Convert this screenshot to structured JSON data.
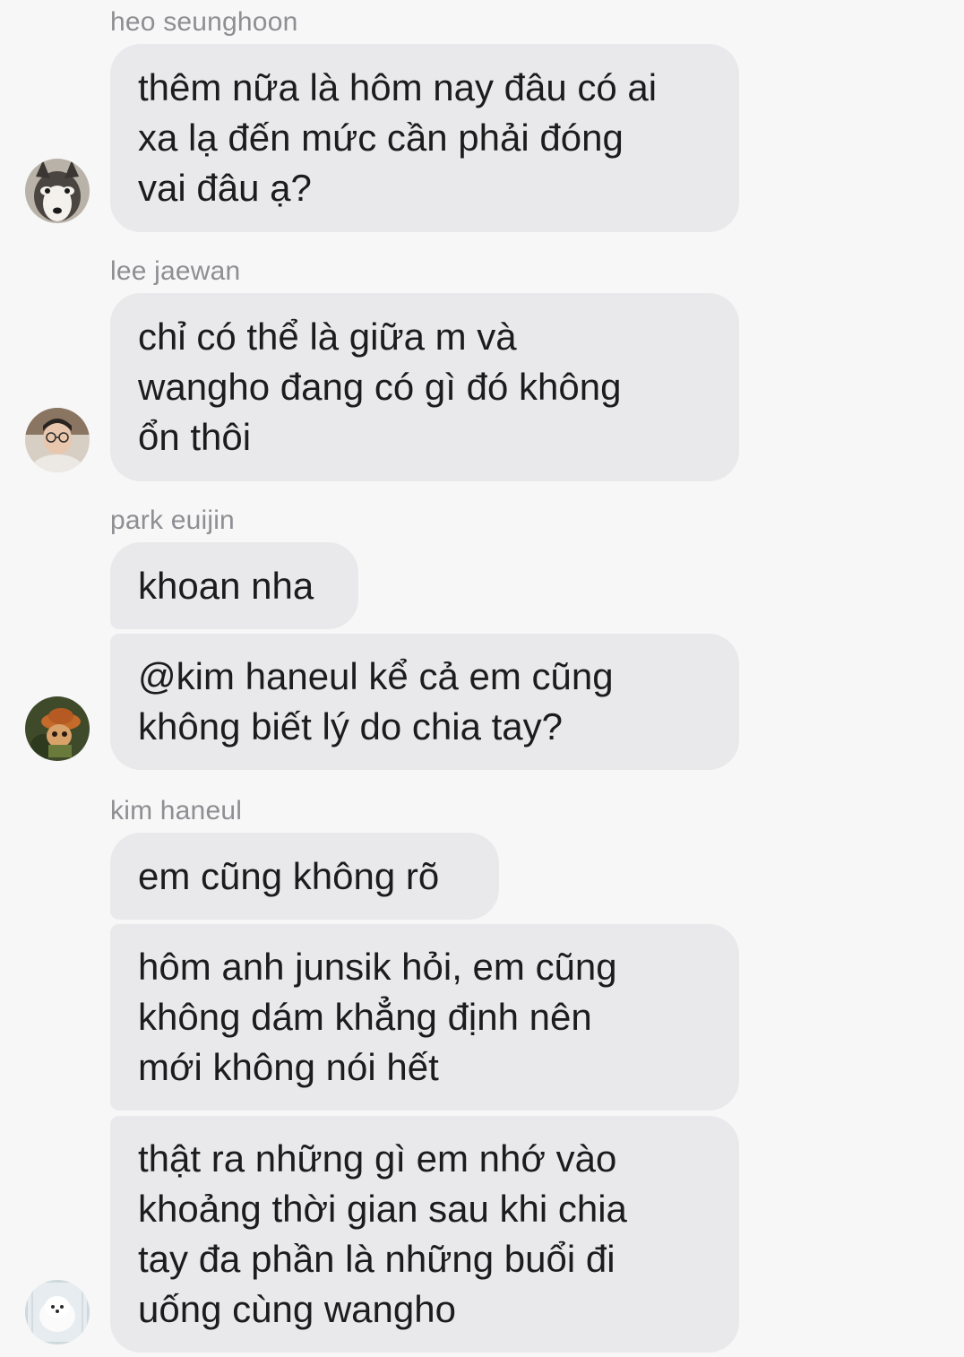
{
  "messages": [
    {
      "sender": "heo seunghoon",
      "avatar_icon": "husky-dog-avatar",
      "bubbles": [
        "thêm nữa là hôm nay đâu có ai\nxa lạ đến mức cần phải đóng\nvai đâu ạ?"
      ]
    },
    {
      "sender": "lee jaewan",
      "avatar_icon": "boy-with-glasses-avatar",
      "bubbles": [
        "chỉ có thể là giữa m và\nwangho đang có gì đó không\nổn thôi"
      ]
    },
    {
      "sender": "park euijin",
      "avatar_icon": "teemo-avatar",
      "bubbles": [
        "khoan nha",
        "@kim haneul kể cả em cũng\nkhông biết lý do chia tay?"
      ]
    },
    {
      "sender": "kim haneul",
      "avatar_icon": "white-puppy-avatar",
      "bubbles": [
        "em cũng không rõ",
        "hôm anh junsik hỏi, em cũng\nkhông dám khẳng định nên\nmới không nói hết",
        "thật ra những gì em nhớ vào\nkhoảng thời gian sau khi chia\ntay đa phần là những buổi đi\nuống cùng wangho"
      ]
    }
  ],
  "colors": {
    "background": "#f7f7f7",
    "bubble": "#e9e9eb",
    "sender_text": "#8e8e93",
    "message_text": "#1c1c1e"
  }
}
